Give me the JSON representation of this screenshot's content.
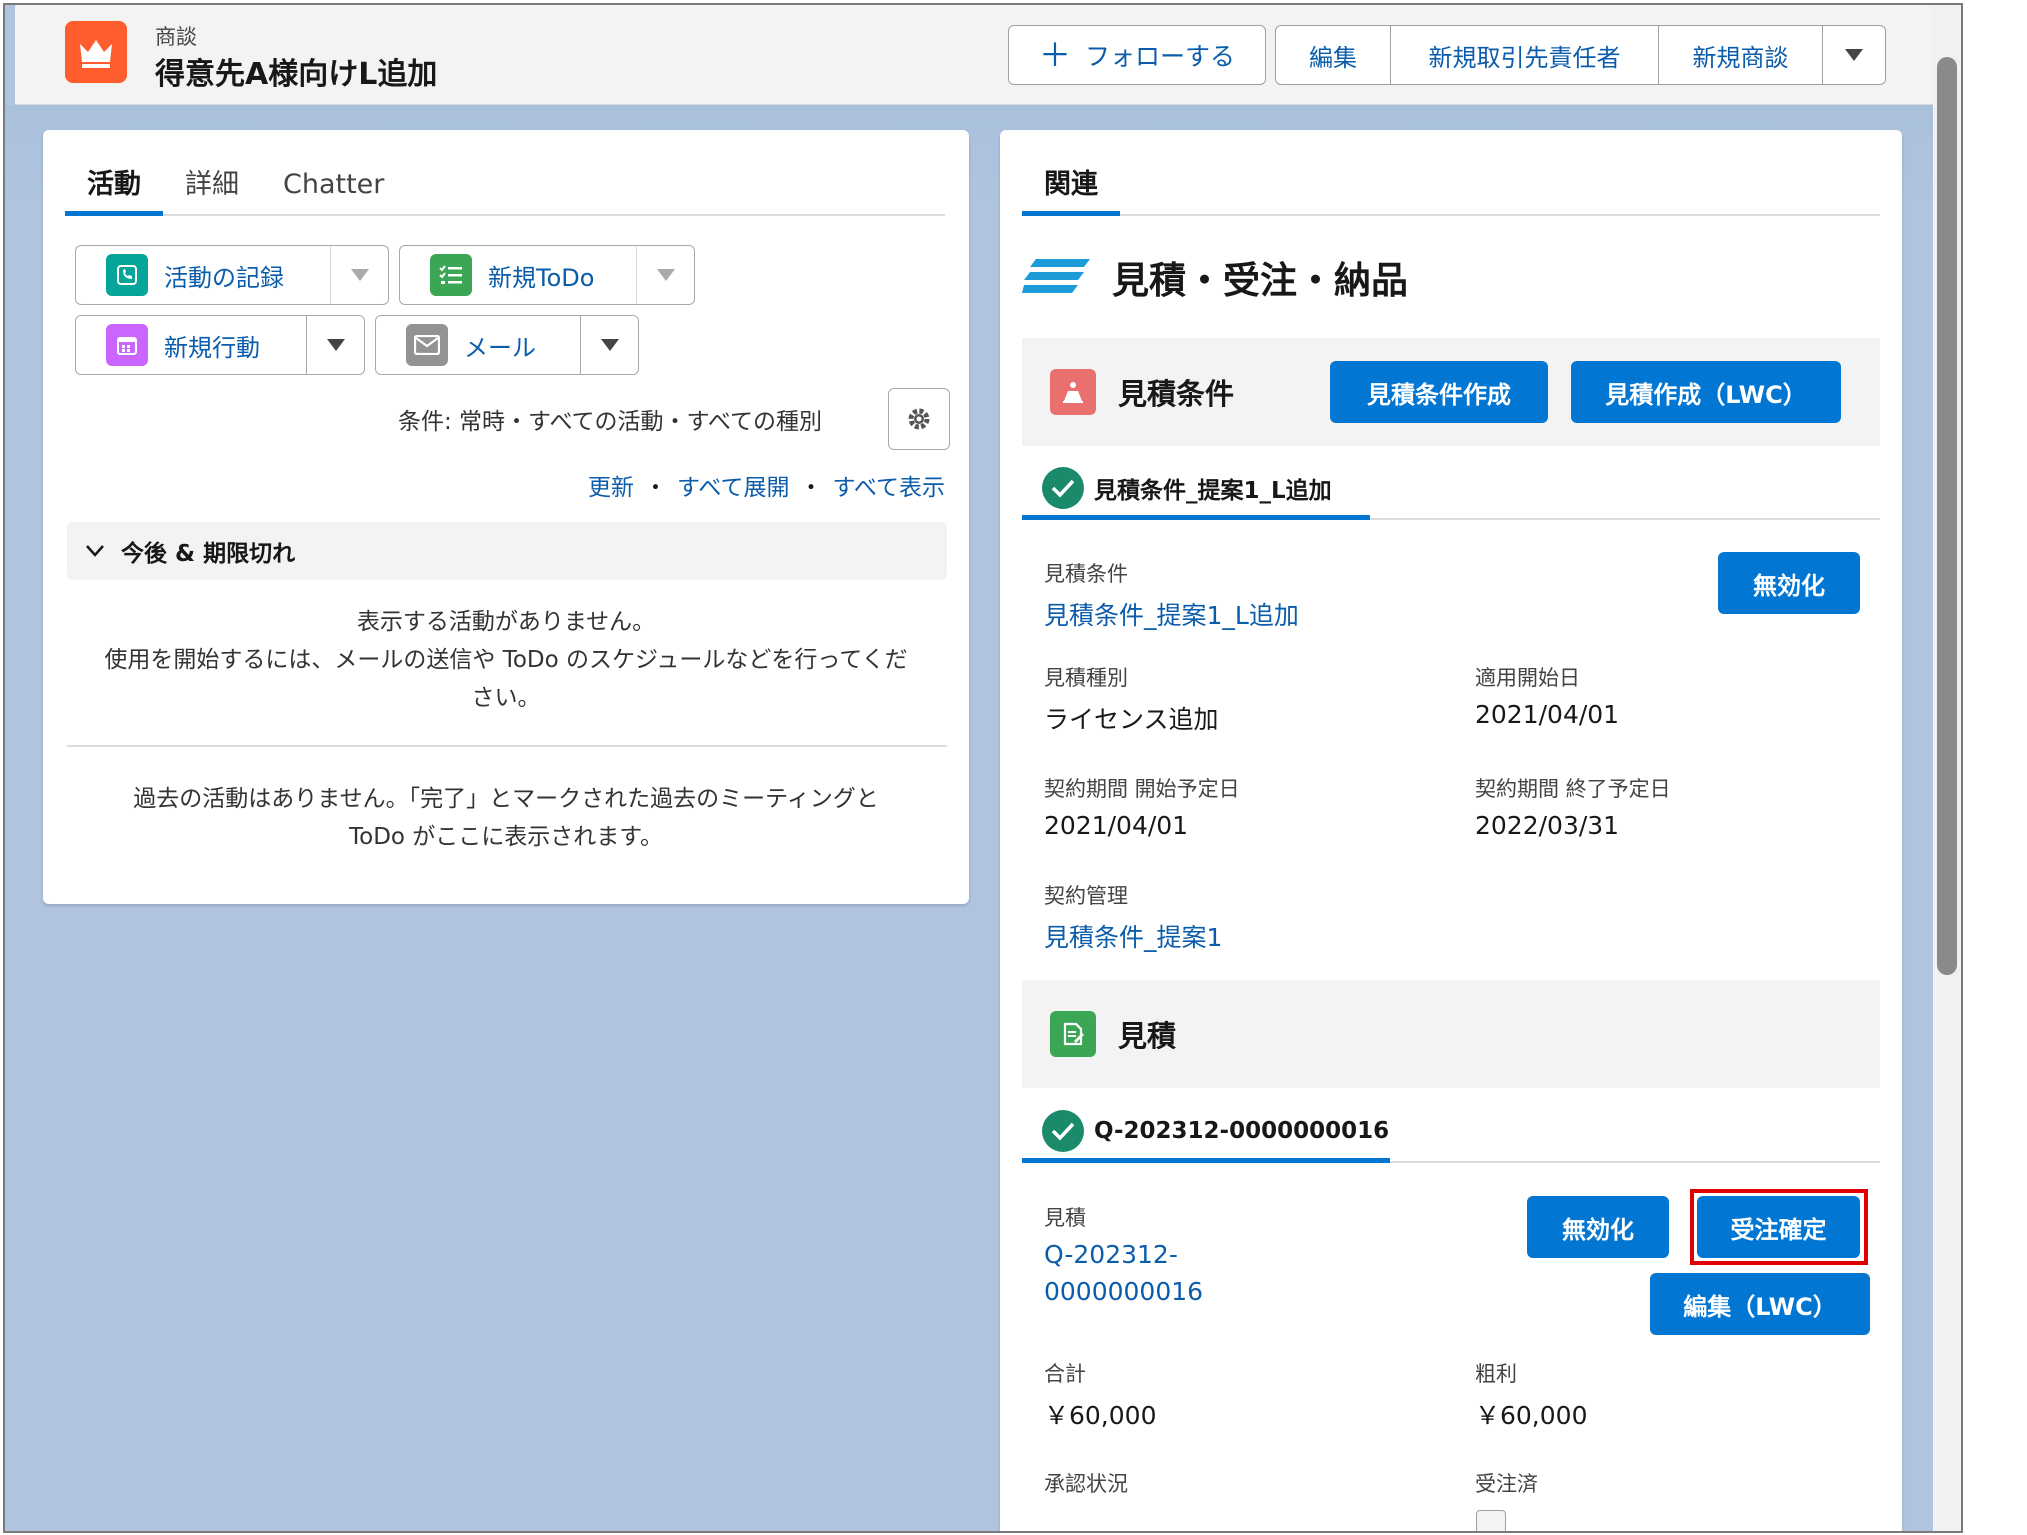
{
  "header": {
    "object_label": "商談",
    "record_title": "得意先A様向けL追加",
    "follow_label": "フォローする",
    "actions": [
      "編集",
      "新規取引先責任者",
      "新規商談"
    ]
  },
  "left": {
    "tabs": [
      {
        "label": "活動",
        "active": true
      },
      {
        "label": "詳細",
        "active": false
      },
      {
        "label": "Chatter",
        "active": false
      }
    ],
    "activity_buttons": {
      "log": "活動の記録",
      "todo": "新規ToDo",
      "event": "新規行動",
      "email": "メール"
    },
    "filter_text": "条件: 常時・すべての活動・すべての種別",
    "links": {
      "refresh": "更新",
      "expand": "すべて展開",
      "show_all": "すべて表示"
    },
    "section_title": "今後 & 期限切れ",
    "empty_line1": "表示する活動がありません。",
    "empty_line2": "使用を開始するには、メールの送信や ToDo のスケジュールなどを行ってくだ",
    "empty_line3": "さい。",
    "past_line1": "過去の活動はありません。「完了」とマークされた過去のミーティングと",
    "past_line2": "ToDo がここに表示されます。"
  },
  "right": {
    "tab_label": "関連",
    "related_title": "見積・受注・納品",
    "quote_cond": {
      "title": "見積条件",
      "btn_create_cond": "見積条件作成",
      "btn_create_quote": "見積作成（LWC）",
      "record_name": "見積条件_提案1_L追加",
      "btn_disable": "無効化",
      "fields": {
        "cond_label": "見積条件",
        "cond_value": "見積条件_提案1_L追加",
        "type_label": "見積種別",
        "type_value": "ライセンス追加",
        "start_label": "適用開始日",
        "start_value": "2021/04/01",
        "cstart_label": "契約期間 開始予定日",
        "cstart_value": "2021/04/01",
        "cend_label": "契約期間 終了予定日",
        "cend_value": "2022/03/31",
        "mgmt_label": "契約管理",
        "mgmt_value": "見積条件_提案1"
      }
    },
    "quote": {
      "title": "見積",
      "record_name": "Q-202312-0000000016",
      "btn_disable": "無効化",
      "btn_confirm": "受注確定",
      "btn_edit": "編集（LWC）",
      "fields": {
        "quote_label": "見積",
        "quote_value_1": "Q-202312-",
        "quote_value_2": "0000000016",
        "total_label": "合計",
        "total_value": "￥60,000",
        "profit_label": "粗利",
        "profit_value": "￥60,000",
        "approval_label": "承認状況",
        "ordered_label": "受注済"
      }
    }
  },
  "colors": {
    "brand": "#0176d3",
    "link": "#0b5cab",
    "highlight": "#e00000",
    "app_icon": "#ff5d2d"
  }
}
